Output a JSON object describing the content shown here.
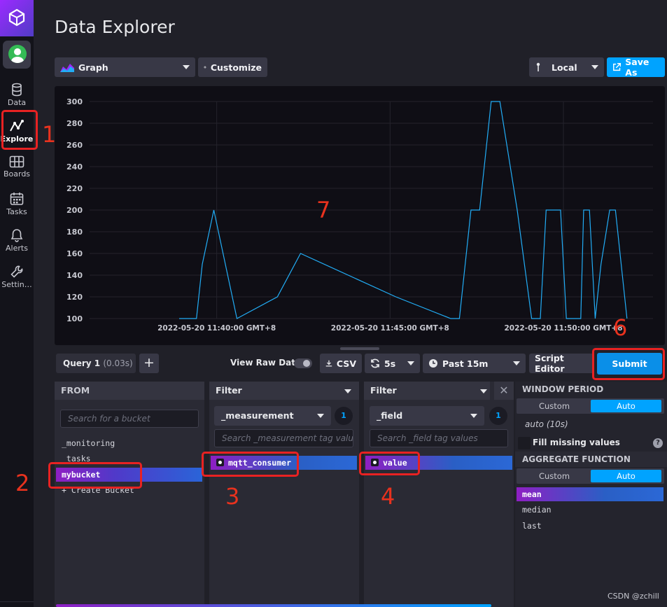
{
  "nav": {
    "items": [
      {
        "label": "Data",
        "icon": "database-icon"
      },
      {
        "label": "Explore",
        "icon": "graph-line-icon"
      },
      {
        "label": "Boards",
        "icon": "grid-icon"
      },
      {
        "label": "Tasks",
        "icon": "calendar-icon"
      },
      {
        "label": "Alerts",
        "icon": "bell-icon"
      },
      {
        "label": "Settin…",
        "icon": "wrench-icon"
      }
    ]
  },
  "page_title": "Data Explorer",
  "toolbar": {
    "view_type": "Graph",
    "customize_label": "Customize",
    "timezone": "Local",
    "save_as_label": "Save As"
  },
  "chart_data": {
    "type": "line",
    "y_ticks": [
      100,
      120,
      140,
      160,
      180,
      200,
      220,
      240,
      260,
      280,
      300
    ],
    "x_ticks": [
      "2022-05-20 11:40:00 GMT+8",
      "2022-05-20 11:45:00 GMT+8",
      "2022-05-20 11:50:00 GMT+8"
    ],
    "ylim": [
      100,
      300
    ],
    "grid": true,
    "series": [
      {
        "color": "#22ADF6",
        "points": [
          [
            "11:38:55",
            100
          ],
          [
            "11:39:25",
            100
          ],
          [
            "11:39:35",
            150
          ],
          [
            "11:39:55",
            200
          ],
          [
            "11:40:35",
            100
          ],
          [
            "11:41:45",
            120
          ],
          [
            "11:42:25",
            160
          ],
          [
            "11:45:10",
            120
          ],
          [
            "11:46:45",
            100
          ],
          [
            "11:47:00",
            100
          ],
          [
            "11:47:20",
            200
          ],
          [
            "11:47:35",
            200
          ],
          [
            "11:47:55",
            300
          ],
          [
            "11:48:10",
            300
          ],
          [
            "11:48:40",
            200
          ],
          [
            "11:49:05",
            100
          ],
          [
            "11:49:20",
            100
          ],
          [
            "11:49:30",
            200
          ],
          [
            "11:49:55",
            200
          ],
          [
            "11:50:05",
            100
          ],
          [
            "11:50:30",
            100
          ],
          [
            "11:50:35",
            200
          ],
          [
            "11:50:45",
            200
          ],
          [
            "11:50:55",
            100
          ],
          [
            "11:51:05",
            150
          ],
          [
            "11:51:20",
            200
          ],
          [
            "11:51:30",
            200
          ],
          [
            "11:51:50",
            100
          ]
        ]
      }
    ],
    "x_range": [
      "11:36:20",
      "11:52:35"
    ]
  },
  "query_bar": {
    "tab_label": "Query 1",
    "tab_time": "(0.03s)",
    "add_label": "+",
    "view_raw_label": "View Raw Data",
    "csv_label": "CSV",
    "refresh_label": "5s",
    "range_label": "Past 15m",
    "script_editor_label": "Script Editor",
    "submit_label": "Submit"
  },
  "from_panel": {
    "header": "FROM",
    "search_placeholder": "Search for a bucket",
    "buckets": [
      "_monitoring",
      "_tasks",
      "mybucket"
    ],
    "selected": "mybucket",
    "create_label": "+ Create Bucket"
  },
  "filter1": {
    "header": "Filter",
    "key": "_measurement",
    "count": "1",
    "search_placeholder": "Search _measurement tag values",
    "value": "mqtt_consumer"
  },
  "filter2": {
    "header": "Filter",
    "key": "_field",
    "count": "1",
    "search_placeholder": "Search _field tag values",
    "value": "value"
  },
  "window": {
    "header": "WINDOW PERIOD",
    "custom_label": "Custom",
    "auto_label": "Auto",
    "value": "auto (10s)",
    "fill_label": "Fill missing values",
    "help": "?"
  },
  "aggregate": {
    "header": "AGGREGATE FUNCTION",
    "custom_label": "Custom",
    "auto_label": "Auto",
    "functions": [
      "mean",
      "median",
      "last"
    ],
    "selected": "mean"
  },
  "annotations": [
    "1",
    "2",
    "3",
    "4",
    "6",
    "7"
  ],
  "watermark": "CSDN @zchill"
}
